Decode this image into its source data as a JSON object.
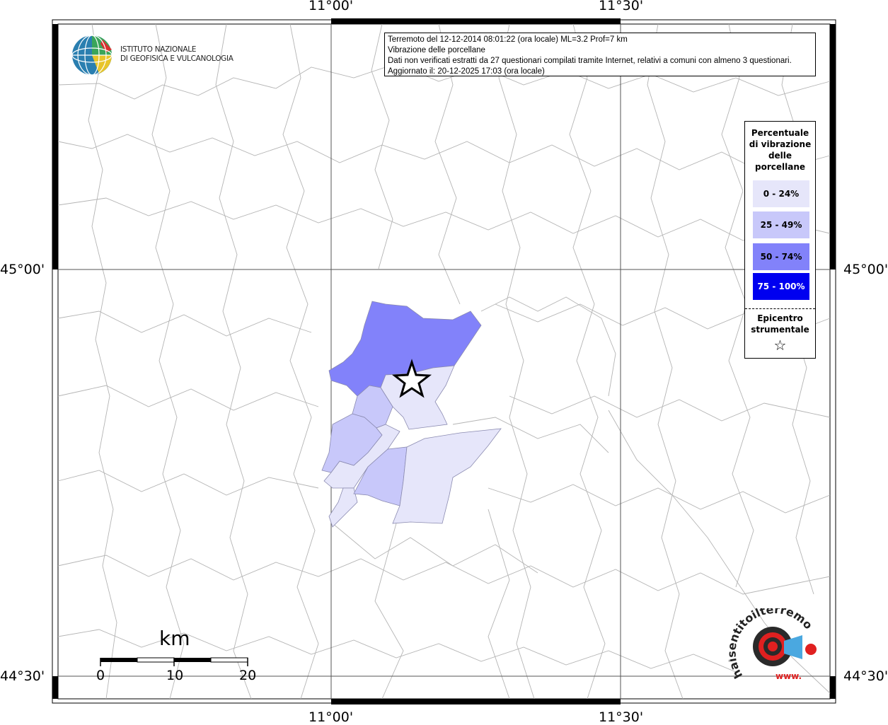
{
  "header": {
    "line1": "Terremoto del 12-12-2014 08:01:22 (ora locale) ML=3.2 Prof=7 km",
    "line2": "Vibrazione delle porcellane",
    "line3": "Dati non verificati estratti da 27 questionari compilati tramite Internet, relativi a comuni con almeno 3 questionari.",
    "line4": "Aggiornato il: 20-12-2025 17:03 (ora locale)"
  },
  "axes": {
    "top_labels": [
      "11°00'",
      "11°30'"
    ],
    "bottom_labels": [
      "11°00'",
      "11°30'"
    ],
    "left_labels": [
      "45°00'",
      "44°30'"
    ],
    "right_labels": [
      "45°00'",
      "44°30'"
    ]
  },
  "logo": {
    "line1": "ISTITUTO NAZIONALE",
    "line2": "DI GEOFISICA E VULCANOLOGIA"
  },
  "legend": {
    "title_lines": [
      "Percentuale",
      "di vibrazione",
      "delle",
      "porcellane"
    ],
    "classes": [
      {
        "label": "0 - 24%",
        "color": "#e6e6fa",
        "text_color": "#000000"
      },
      {
        "label": "25 - 49%",
        "color": "#c8c8fa",
        "text_color": "#000000"
      },
      {
        "label": "50 - 74%",
        "color": "#8282fa",
        "text_color": "#000000"
      },
      {
        "label": "75 - 100%",
        "color": "#0000f0",
        "text_color": "#ffffff"
      }
    ],
    "epicenter_lines": [
      "Epicentro",
      "strumentale"
    ],
    "epicenter_symbol": "☆"
  },
  "scale": {
    "unit": "km",
    "ticks": [
      "0",
      "10",
      "20"
    ]
  },
  "watermark": {
    "text": "haisentitoilterremoto.it",
    "bottom_text": "www."
  }
}
